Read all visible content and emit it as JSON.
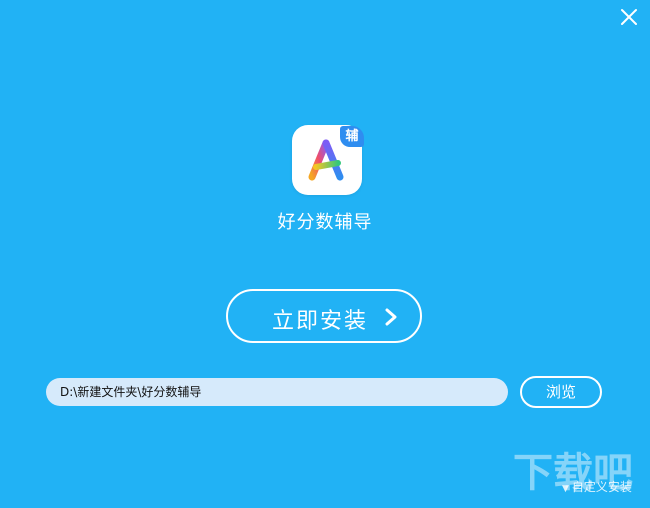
{
  "app": {
    "name": "好分数辅导",
    "badge": "辅"
  },
  "install": {
    "label": "立即安装"
  },
  "path": {
    "value": "D:\\新建文件夹\\好分数辅导"
  },
  "browse": {
    "label": "浏览"
  },
  "footer": {
    "custom_install": "自定义安装",
    "watermark": "下载吧"
  },
  "icons": {
    "close": "close-icon",
    "arrow": "chevron-right-icon",
    "logo": "letter-a-logo-icon"
  },
  "colors": {
    "background": "#21b2f5",
    "badge": "#2f8df0",
    "input_bg": "#d6eafb"
  }
}
